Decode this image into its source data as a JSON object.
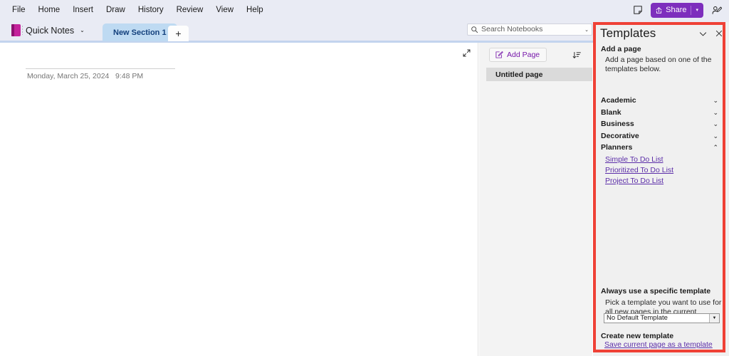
{
  "app": {
    "menu": [
      {
        "label": "File"
      },
      {
        "label": "Home"
      },
      {
        "label": "Insert"
      },
      {
        "label": "Draw"
      },
      {
        "label": "History"
      },
      {
        "label": "Review"
      },
      {
        "label": "View"
      },
      {
        "label": "Help"
      }
    ],
    "sticky_note_icon": "sticky-note-icon",
    "share": {
      "label": "Share",
      "chevron": "▾",
      "color": "#7d2ebd",
      "icon": "share-icon"
    },
    "annotate_icon": "person-annotate-icon"
  },
  "notebook": {
    "name": "Quick Notes",
    "chevron": "⌄",
    "color": "#c4229b",
    "icon": "notebook-icon"
  },
  "tabs": {
    "sections": [
      {
        "label": "New Section 1",
        "active": true
      }
    ],
    "add_label": "+",
    "active_bg": "#bedaf2",
    "active_text": "#13407c"
  },
  "search": {
    "placeholder": "Search Notebooks",
    "icon": "search-icon",
    "chevron": "⌄"
  },
  "canvas": {
    "expand_icon": "expand-diagonal-icon",
    "page_date": "Monday, March 25, 2024",
    "page_time": "9:48 PM"
  },
  "pagelist": {
    "add_page_label": "Add Page",
    "add_page_icon": "edit-pencil-icon",
    "sort_icon": "sort-descending-icon",
    "pages": [
      {
        "title": "Untitled page",
        "selected": true
      }
    ]
  },
  "templates": {
    "title": "Templates",
    "collapse_icon": "chevron-down-icon",
    "close_icon": "close-icon",
    "add_page_heading": "Add a page",
    "add_page_description": "Add a page based on one of the templates below.",
    "categories": [
      {
        "label": "Academic",
        "expanded": false,
        "chevron": "⌄"
      },
      {
        "label": "Blank",
        "expanded": false,
        "chevron": "⌄"
      },
      {
        "label": "Business",
        "expanded": false,
        "chevron": "⌄"
      },
      {
        "label": "Decorative",
        "expanded": false,
        "chevron": "⌄"
      },
      {
        "label": "Planners",
        "expanded": true,
        "chevron": "⌃"
      }
    ],
    "template_links": [
      {
        "label": "Simple To Do List"
      },
      {
        "label": "Prioritized To Do List"
      },
      {
        "label": "Project To Do List"
      }
    ],
    "always_use_heading": "Always use a specific template",
    "always_use_description": "Pick a template you want to use for all new pages in the current section.",
    "default_template_value": "No Default Template",
    "default_template_arrow": "▼",
    "create_new_heading": "Create new template",
    "save_link_label": "Save current page as a template",
    "link_color": "#5b2da8"
  },
  "annotation": {
    "color": "#ef4136",
    "label": "templates-pane-highlight"
  }
}
